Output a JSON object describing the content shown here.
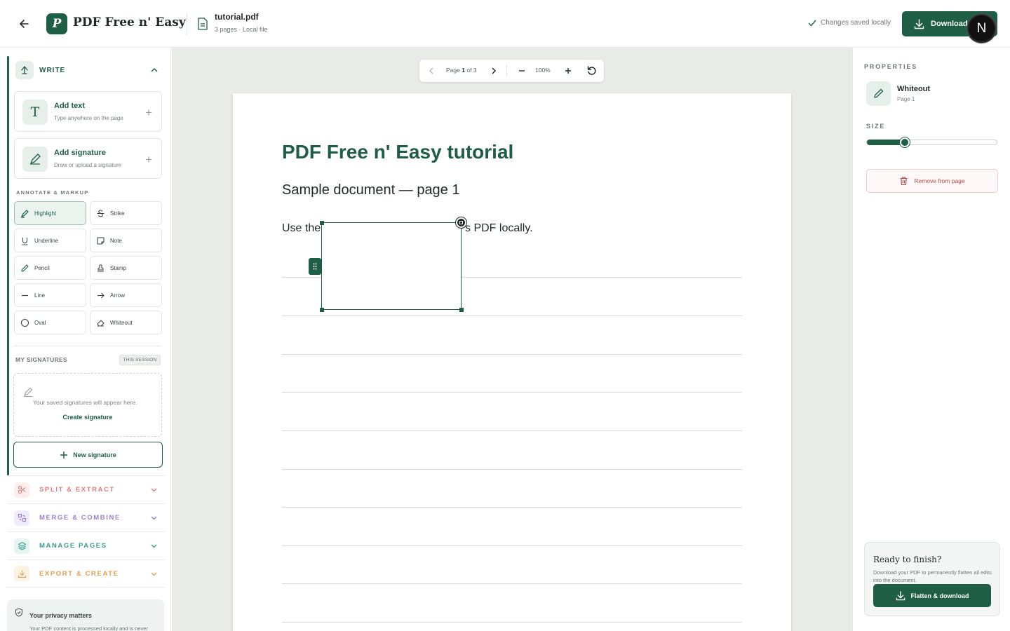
{
  "header": {
    "logo_letter": "P",
    "app_name": "PDF Free n' Easy",
    "file_name": "tutorial.pdf",
    "file_meta": "3 pages · Local file",
    "save_status": "Changes saved locally",
    "download_label": "Download",
    "avatar_letter": "N"
  },
  "sidebar": {
    "write": {
      "title": "WRITE",
      "tools": [
        {
          "title": "Add text",
          "subtitle": "Type anywhere on the page"
        },
        {
          "title": "Add signature",
          "subtitle": "Draw or upload a signature"
        }
      ]
    },
    "annotate": {
      "title": "ANNOTATE & MARKUP",
      "items": [
        {
          "label": "Highlight",
          "icon": "highlighter-icon",
          "active": true
        },
        {
          "label": "Strike",
          "icon": "strikethrough-icon"
        },
        {
          "label": "Underline",
          "icon": "underline-icon"
        },
        {
          "label": "Note",
          "icon": "note-icon"
        },
        {
          "label": "Pencil",
          "icon": "pencil-icon"
        },
        {
          "label": "Stamp",
          "icon": "stamp-icon"
        },
        {
          "label": "Line",
          "icon": "line-icon"
        },
        {
          "label": "Arrow",
          "icon": "arrow-right-icon"
        },
        {
          "label": "Oval",
          "icon": "circle-icon"
        },
        {
          "label": "Whiteout",
          "icon": "eraser-icon"
        }
      ]
    },
    "signatures": {
      "title": "MY SIGNATURES",
      "badge": "THIS SESSION",
      "empty_text": "Your saved signatures will appear here.",
      "create_link": "Create signature",
      "new_button": "New signature"
    },
    "sections": [
      {
        "title": "SPLIT & EXTRACT",
        "color": "#e07b7b",
        "bg": "#fdeeee"
      },
      {
        "title": "MERGE & COMBINE",
        "color": "#9b7fd1",
        "bg": "#f1ecfb"
      },
      {
        "title": "MANAGE PAGES",
        "color": "#3d9c92",
        "bg": "#e6f4f2"
      },
      {
        "title": "EXPORT & CREATE",
        "color": "#e0a04e",
        "bg": "#fcf2e3"
      }
    ],
    "privacy": {
      "title": "Your privacy matters",
      "text": "Your PDF content is processed locally and is never"
    }
  },
  "toolbar": {
    "page_prefix": "Page",
    "page_current": "1",
    "page_suffix": "of 3",
    "zoom": "100%"
  },
  "document": {
    "title": "PDF Free n' Easy tutorial",
    "subtitle": "Sample document — page 1",
    "body_left": "Use the",
    "body_right": "s PDF locally."
  },
  "properties": {
    "label": "PROPERTIES",
    "tool_name": "Whiteout",
    "tool_page": "Page 1",
    "size_label": "SIZE",
    "size_value": 0.29,
    "remove_label": "Remove from page"
  },
  "finish": {
    "title": "Ready to finish?",
    "text": "Download your PDF to permanently flatten all edits into the document.",
    "button": "Flatten & download"
  },
  "colors": {
    "brand": "#1d5e44",
    "danger": "#b34848"
  }
}
